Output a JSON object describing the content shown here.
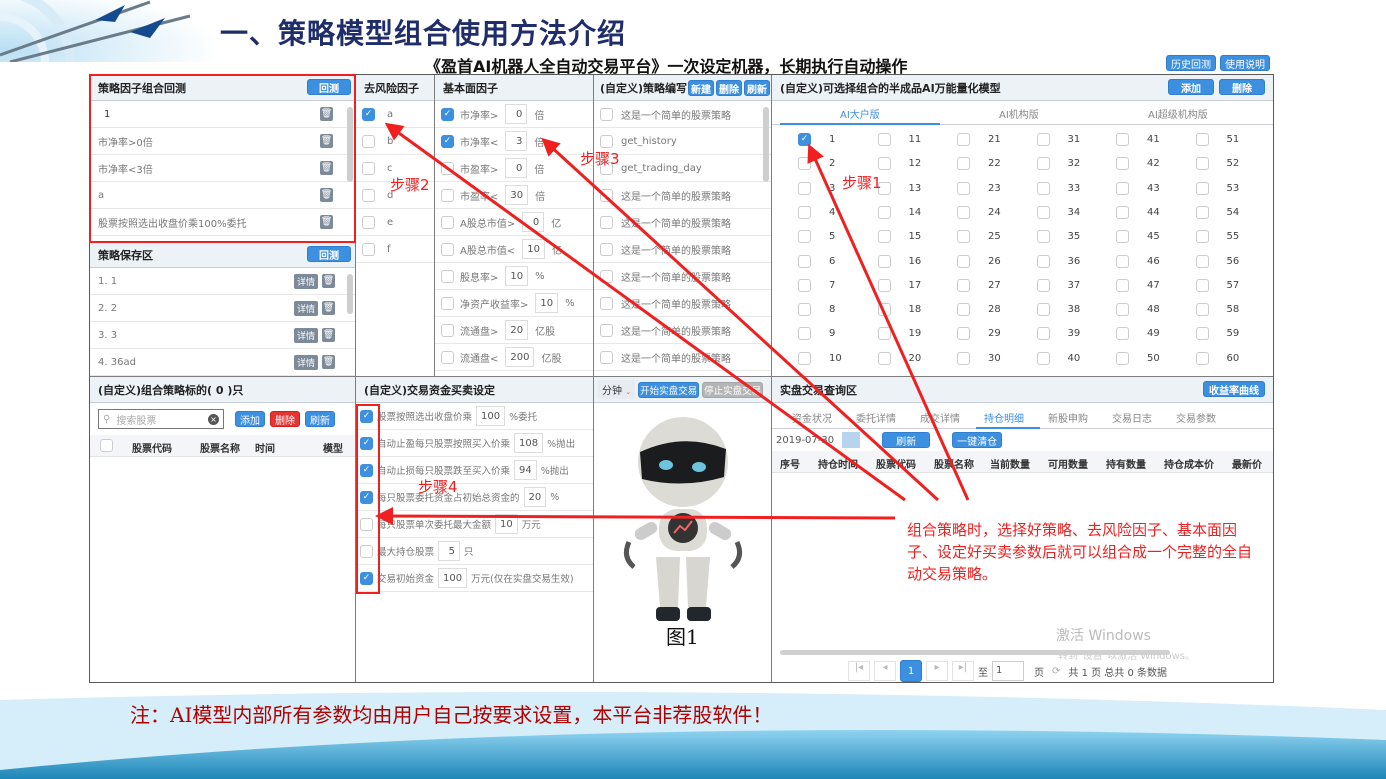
{
  "slide": {
    "title": "一、策略模型组合使用方法介绍",
    "subtitle": "《盈首AI机器人全自动交易平台》一次设定机器，长期执行自动操作",
    "top_buttons": [
      "历史回测",
      "使用说明"
    ],
    "footer_note": "注：AI模型内部所有参数均由用户自己按要求设置，本平台非荐股软件！",
    "figure_caption": "图1"
  },
  "factor_backtest": {
    "title": "策略因子组合回测",
    "button": "回测",
    "items": [
      "1",
      "市净率>0倍",
      "市净率<3倍",
      "a",
      "股票按照选出收盘价乘100%委托"
    ]
  },
  "strategy_save": {
    "title": "策略保存区",
    "button": "回测",
    "detail_label": "详情",
    "items": [
      "1.  1",
      "2.  2",
      "3.  3",
      "4.  36ad"
    ]
  },
  "risk_factors": {
    "title": "去风险因子",
    "items": [
      {
        "label": "a",
        "checked": true
      },
      {
        "label": "b",
        "checked": false
      },
      {
        "label": "c",
        "checked": false
      },
      {
        "label": "d",
        "checked": false
      },
      {
        "label": "e",
        "checked": false
      },
      {
        "label": "f",
        "checked": false
      }
    ]
  },
  "fundamental_factors": {
    "title": "基本面因子",
    "items": [
      {
        "label": "市净率>",
        "value": "0",
        "unit": "倍",
        "checked": true
      },
      {
        "label": "市净率<",
        "value": "3",
        "unit": "倍",
        "checked": true
      },
      {
        "label": "市盈率>",
        "value": "0",
        "unit": "倍",
        "checked": false
      },
      {
        "label": "市盈率<",
        "value": "30",
        "unit": "倍",
        "checked": false
      },
      {
        "label": "A股总市值>",
        "value": "0",
        "unit": "亿",
        "checked": false
      },
      {
        "label": "A股总市值<",
        "value": "10",
        "unit": "亿",
        "checked": false
      },
      {
        "label": "股息率>",
        "value": "10",
        "unit": "%",
        "checked": false
      },
      {
        "label": "净资产收益率>",
        "value": "10",
        "unit": "%",
        "checked": false
      },
      {
        "label": "流通盘>",
        "value": "20",
        "unit": "亿股",
        "checked": false
      },
      {
        "label": "流通盘<",
        "value": "200",
        "unit": "亿股",
        "checked": false
      }
    ]
  },
  "custom_strategy": {
    "title": "(自定义)策略编写",
    "buttons": [
      "新建",
      "删除",
      "刷新"
    ],
    "items": [
      "这是一个简单的股票策略",
      "get_history",
      "get_trading_day",
      "这是一个简单的股票策略",
      "这是一个简单的股票策略",
      "这是一个简单的股票策略",
      "这是一个简单的股票策略",
      "这是一个简单的股票策略",
      "这是一个简单的股票策略",
      "这是一个简单的股票策略"
    ]
  },
  "ai_models": {
    "title": "(自定义)可选择组合的半成品AI万能量化模型",
    "buttons": [
      "添加",
      "删除"
    ],
    "tabs": [
      "AI大户版",
      "AI机构版",
      "AI超级机构版"
    ],
    "active_tab": 0,
    "checked": [
      "1"
    ]
  },
  "stock_targets": {
    "title": "(自定义)组合策略标的( 0 )只",
    "search_placeholder": "搜索股票",
    "buttons": [
      "添加",
      "删除",
      "刷新"
    ],
    "columns": [
      "股票代码",
      "股票名称",
      "时间",
      "模型"
    ]
  },
  "trade_settings": {
    "title": "(自定义)交易资金买卖设定",
    "items": [
      {
        "pre": "股票按照选出收盘价乘",
        "value": "100",
        "post": "%委托",
        "checked": true
      },
      {
        "pre": "自动止盈每只股票按照买入价乘",
        "value": "108",
        "post": "%抛出",
        "checked": true
      },
      {
        "pre": "自动止损每只股票跌至买入价乘",
        "value": "94",
        "post": "%抛出",
        "checked": true
      },
      {
        "pre": "每只股票委托资金占初始总资金的",
        "value": "20",
        "post": "%",
        "checked": true
      },
      {
        "pre": "每只股票单次委托最大金额",
        "value": "10",
        "post": "万元",
        "checked": false
      },
      {
        "pre": "最大持仓股票",
        "value": "5",
        "post": "只",
        "checked": false
      },
      {
        "pre": "交易初始资金",
        "value": "100",
        "post": "万元(仅在实盘交易生效)",
        "checked": true
      }
    ]
  },
  "robot_panel": {
    "interval": "分钟",
    "start_button": "开始实盘交易",
    "stop_button": "停止实盘交易"
  },
  "live_query": {
    "title": "实盘交易查询区",
    "curve_button": "收益率曲线",
    "tabs": [
      "资金状况",
      "委托详情",
      "成交详情",
      "持仓明细",
      "新股申购",
      "交易日志",
      "交易参数"
    ],
    "active_tab": 3,
    "date": "2019-07-30",
    "refresh_button": "刷新",
    "clear_button": "一键清仓",
    "columns": [
      "序号",
      "持仓时间",
      "股票代码",
      "股票名称",
      "当前数量",
      "可用数量",
      "持有数量",
      "持仓成本价",
      "最新价"
    ],
    "pager": {
      "current": "1",
      "goto_label": "至",
      "goto_value": "1",
      "page_label": "页",
      "summary": "共 1 页  总共 0 条数据"
    },
    "watermark_line1": "激活 Windows",
    "watermark_line2": "转到\"设置\"以激活 Windows。"
  },
  "annotations": {
    "step1": "步骤1",
    "step2": "步骤2",
    "step3": "步骤3",
    "step4": "步骤4",
    "explanation": "组合策略时，选择好策略、去风险因子、基本面因子、设定好买卖参数后就可以组合成一个完整的全自动交易策略。"
  }
}
